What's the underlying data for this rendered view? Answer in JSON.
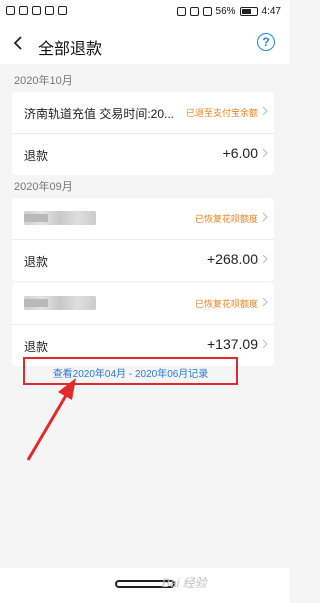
{
  "status_bar": {
    "battery": "56%",
    "time": "4:47"
  },
  "header": {
    "title": "全部退款"
  },
  "sections": [
    {
      "title": "2020年10月",
      "items": [
        {
          "name": "济南轨道充值  交易时间:20...",
          "status": "已退至支付宝余额",
          "label": "退款",
          "amount": "+6.00"
        }
      ]
    },
    {
      "title": "2020年09月",
      "items": [
        {
          "name": "",
          "status": "已恢复花呗额度",
          "label": "退款",
          "amount": "+268.00"
        },
        {
          "name": "",
          "status": "已恢复花呗额度",
          "label": "退款",
          "amount": "+137.09"
        }
      ]
    }
  ],
  "view_more_link": "查看2020年04月 - 2020年06月记录",
  "watermark": "Bai 经验",
  "colors": {
    "status": "#e8821e",
    "link": "#2b78d6",
    "highlight": "#e12a2a",
    "help": "#1e88e5"
  }
}
